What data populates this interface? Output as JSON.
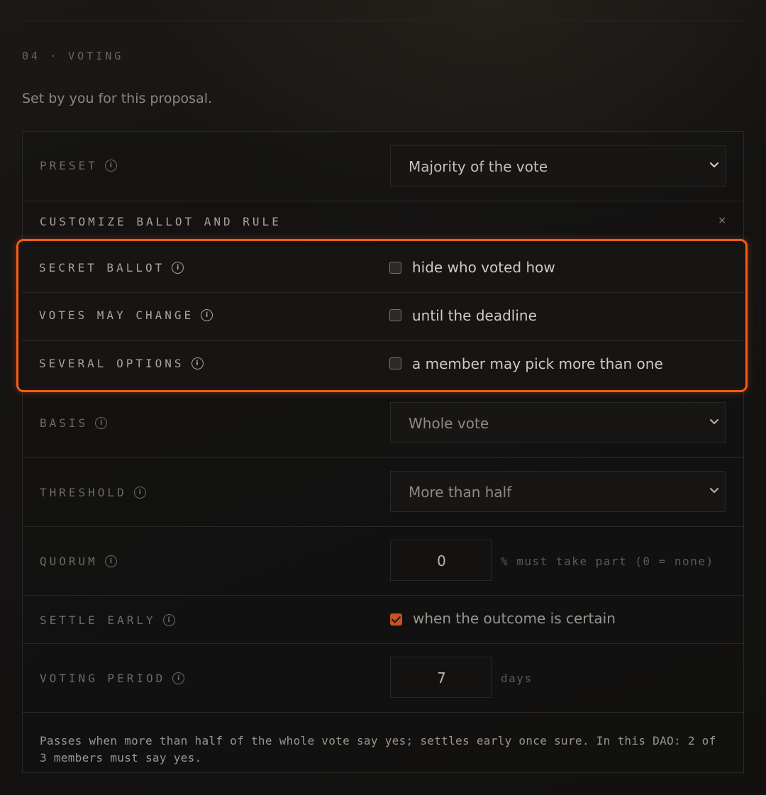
{
  "section": {
    "label": "04 · VOTING",
    "description": "Set by you for this proposal."
  },
  "preset": {
    "label": "PRESET",
    "value": "Majority of the vote"
  },
  "customize": {
    "label": "CUSTOMIZE BALLOT AND RULE",
    "close": "×"
  },
  "options": [
    {
      "label": "SECRET BALLOT",
      "text": "hide who voted how",
      "checked": false
    },
    {
      "label": "VOTES MAY CHANGE",
      "text": "until the deadline",
      "checked": false
    },
    {
      "label": "SEVERAL OPTIONS",
      "text": "a member may pick more than one",
      "checked": false
    }
  ],
  "basis": {
    "label": "BASIS",
    "value": "Whole vote"
  },
  "threshold": {
    "label": "THRESHOLD",
    "value": "More than half"
  },
  "quorum": {
    "label": "QUORUM",
    "value": "0",
    "suffix": "% must take part (0 = none)"
  },
  "settle_early": {
    "label": "SETTLE EARLY",
    "text": "when the outcome is certain",
    "checked": true
  },
  "voting_period": {
    "label": "VOTING PERIOD",
    "value": "7",
    "suffix": "days"
  },
  "summary": "Passes when more than half of the whole vote say yes; settles early once sure. In this DAO: 2 of 3 members must say yes.",
  "icons": {
    "info": "i",
    "chevron": "chevron-down-icon"
  },
  "colors": {
    "accent": "#ff5b14",
    "checkbox_on": "#c8531f"
  }
}
